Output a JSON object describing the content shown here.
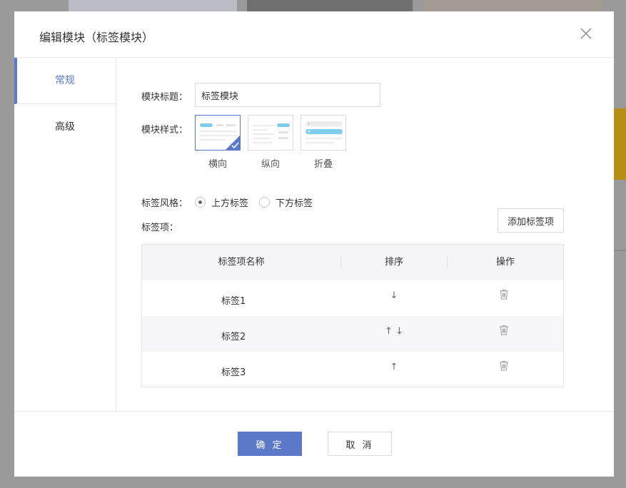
{
  "dialog": {
    "title": "编辑模块（标签模块）",
    "close_icon": "close-icon"
  },
  "sidenav": {
    "items": [
      {
        "label": "常规",
        "active": true
      },
      {
        "label": "高级",
        "active": false
      }
    ]
  },
  "form": {
    "title_label": "模块标题：",
    "title_value": "标签模块",
    "style_label": "模块样式：",
    "style_options": [
      {
        "label": "横向",
        "selected": true
      },
      {
        "label": "纵向",
        "selected": false
      },
      {
        "label": "折叠",
        "selected": false
      }
    ],
    "tab_style_label": "标签风格：",
    "tab_style_options": [
      {
        "label": "上方标签",
        "checked": true
      },
      {
        "label": "下方标签",
        "checked": false
      }
    ],
    "tab_items_label": "标签项：",
    "add_button": "添加标签项"
  },
  "table": {
    "columns": [
      "标签项名称",
      "排序",
      "操作"
    ],
    "rows": [
      {
        "name": "标签1",
        "sort": "↓"
      },
      {
        "name": "标签2",
        "sort": "↑ ↓"
      },
      {
        "name": "标签3",
        "sort": "↑"
      }
    ],
    "delete_icon": "trash-icon"
  },
  "footer": {
    "ok": "确 定",
    "cancel": "取 消"
  },
  "colors": {
    "accent": "#5b79c8",
    "preview_blue": "#7fcdee"
  }
}
